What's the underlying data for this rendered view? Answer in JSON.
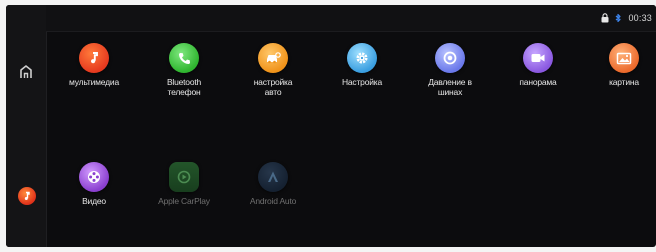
{
  "status": {
    "clock": "00:33"
  },
  "colors": {
    "background": "#0c0c0e",
    "multimedia": "#e63a1f",
    "bluetooth": "#3cc43c",
    "car_settings": "#f2a21e",
    "settings": "#58b8ea",
    "tire_pressure": "#7b8df0",
    "panorama": "#9a6ee8",
    "picture": "#f07a3c",
    "video": "#9b5ad6",
    "carplay_dim": "#1f4a22",
    "android_auto_dim": "#1b2a3a"
  },
  "apps": [
    {
      "label": "мультимедиа",
      "icon": "music-note-icon"
    },
    {
      "label": "Bluetooth\nтелефон",
      "icon": "phone-icon"
    },
    {
      "label": "настройка\nавто",
      "icon": "car-settings-icon"
    },
    {
      "label": "Настройка",
      "icon": "gear-icon"
    },
    {
      "label": "Давление в\nшинах",
      "icon": "tire-pressure-icon"
    },
    {
      "label": "панорама",
      "icon": "camera-icon"
    },
    {
      "label": "картина",
      "icon": "picture-icon"
    },
    {
      "label": "Видео",
      "icon": "film-reel-icon"
    },
    {
      "label": "Apple CarPlay",
      "icon": "carplay-icon"
    },
    {
      "label": "Android Auto",
      "icon": "android-auto-icon"
    }
  ]
}
